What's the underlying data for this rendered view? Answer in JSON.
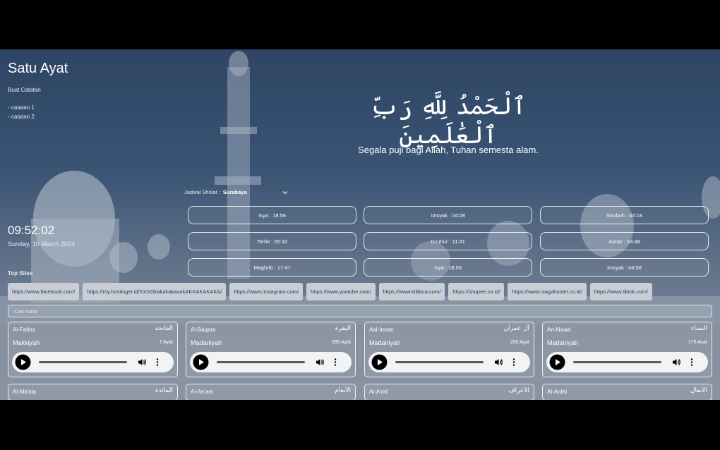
{
  "app": {
    "title": "Satu Ayat"
  },
  "notes": {
    "title": "Buat Catatan",
    "items": [
      "- catatan 1",
      "- catatan 2"
    ]
  },
  "ayat": {
    "arabic": "ٱلْحَمْدُ لِلَّهِ رَبِّ ٱلْعَٰلَمِينَ",
    "translation": "Segala puji bagi Allah, Tuhan semesta alam."
  },
  "clock": {
    "time": "09:52:02",
    "date": "Sunday, 10 March 2024"
  },
  "jadwal": {
    "label": "Jadwal Sholat :",
    "city": "Surabaya",
    "times": [
      "Isya : 18:56",
      "Imsyak : 04:08",
      "Shubuh : 04:18",
      "Terbit : 05:32",
      "Dzuhur : 11:41",
      "Ashar : 14:48",
      "Maghrib : 17:47",
      "Isya : 18:56",
      "Imsyak : 04:08"
    ]
  },
  "top_sites": {
    "label": "Top Sites",
    "items": [
      "https://www.facebook.com/",
      "https://my.hostinger.id/XXXOkakakakaoakAKKAKAKAKA/",
      "https://www.instagram.com/",
      "https://www.youtube.com/",
      "https://www.klikbca.com/",
      "https://shopee.co.id/",
      "https://www.niagahoster.co.id/",
      "https://www.tiktok.com/"
    ]
  },
  "search": {
    "placeholder": "Cari surat"
  },
  "surahs": [
    {
      "name": "Al-Fatiha",
      "arabic": "الفاتحة",
      "type": "Makkiyah",
      "ayat": "7 Ayat"
    },
    {
      "name": "Al-Baqara",
      "arabic": "البقرة",
      "type": "Madaniyah",
      "ayat": "286 Ayat"
    },
    {
      "name": "Aal-Imran",
      "arabic": "آل عمران",
      "type": "Madaniyah",
      "ayat": "200 Ayat"
    },
    {
      "name": "An-Nisaa'",
      "arabic": "النساء",
      "type": "Madaniyah",
      "ayat": "176 Ayat"
    },
    {
      "name": "Al-Ma'ida",
      "arabic": "المائدة"
    },
    {
      "name": "Al-An'am",
      "arabic": "الأنعام"
    },
    {
      "name": "Al-A'raf",
      "arabic": "الأعراف"
    },
    {
      "name": "Al-Anfal",
      "arabic": "الأنفال"
    }
  ],
  "colors": {
    "background": "#3a5474",
    "chip": "#c9ced6",
    "player": "#f1f3f4"
  }
}
